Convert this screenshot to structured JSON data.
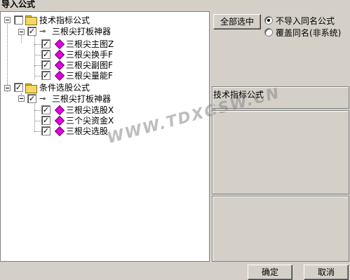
{
  "window": {
    "title": "导入公式"
  },
  "tree": {
    "root1": {
      "label": "技术指标公式",
      "checked": false
    },
    "root1_child": {
      "label": "三根尖打板神器",
      "checked": true
    },
    "root1_leaves": [
      "三根尖主图Z",
      "三根尖换手F",
      "三根尖副图F",
      "三根尖量能F"
    ],
    "root2": {
      "label": "条件选股公式",
      "checked": true
    },
    "root2_child": {
      "label": "三根尖打板神器",
      "checked": true
    },
    "root2_leaves": [
      "三根尖选股X",
      "三个尖资金X",
      "三根尖选股"
    ]
  },
  "right": {
    "select_all_label": "全部选中",
    "radio_options": [
      {
        "label": "不导入同名公式",
        "selected": true
      },
      {
        "label": "覆盖同名(非系统)",
        "selected": false
      }
    ],
    "info_title": "技术指标公式"
  },
  "watermark": "WWW.TDXGSW.CN",
  "footer": {
    "ok_label": "确定",
    "cancel_label": "取消"
  }
}
